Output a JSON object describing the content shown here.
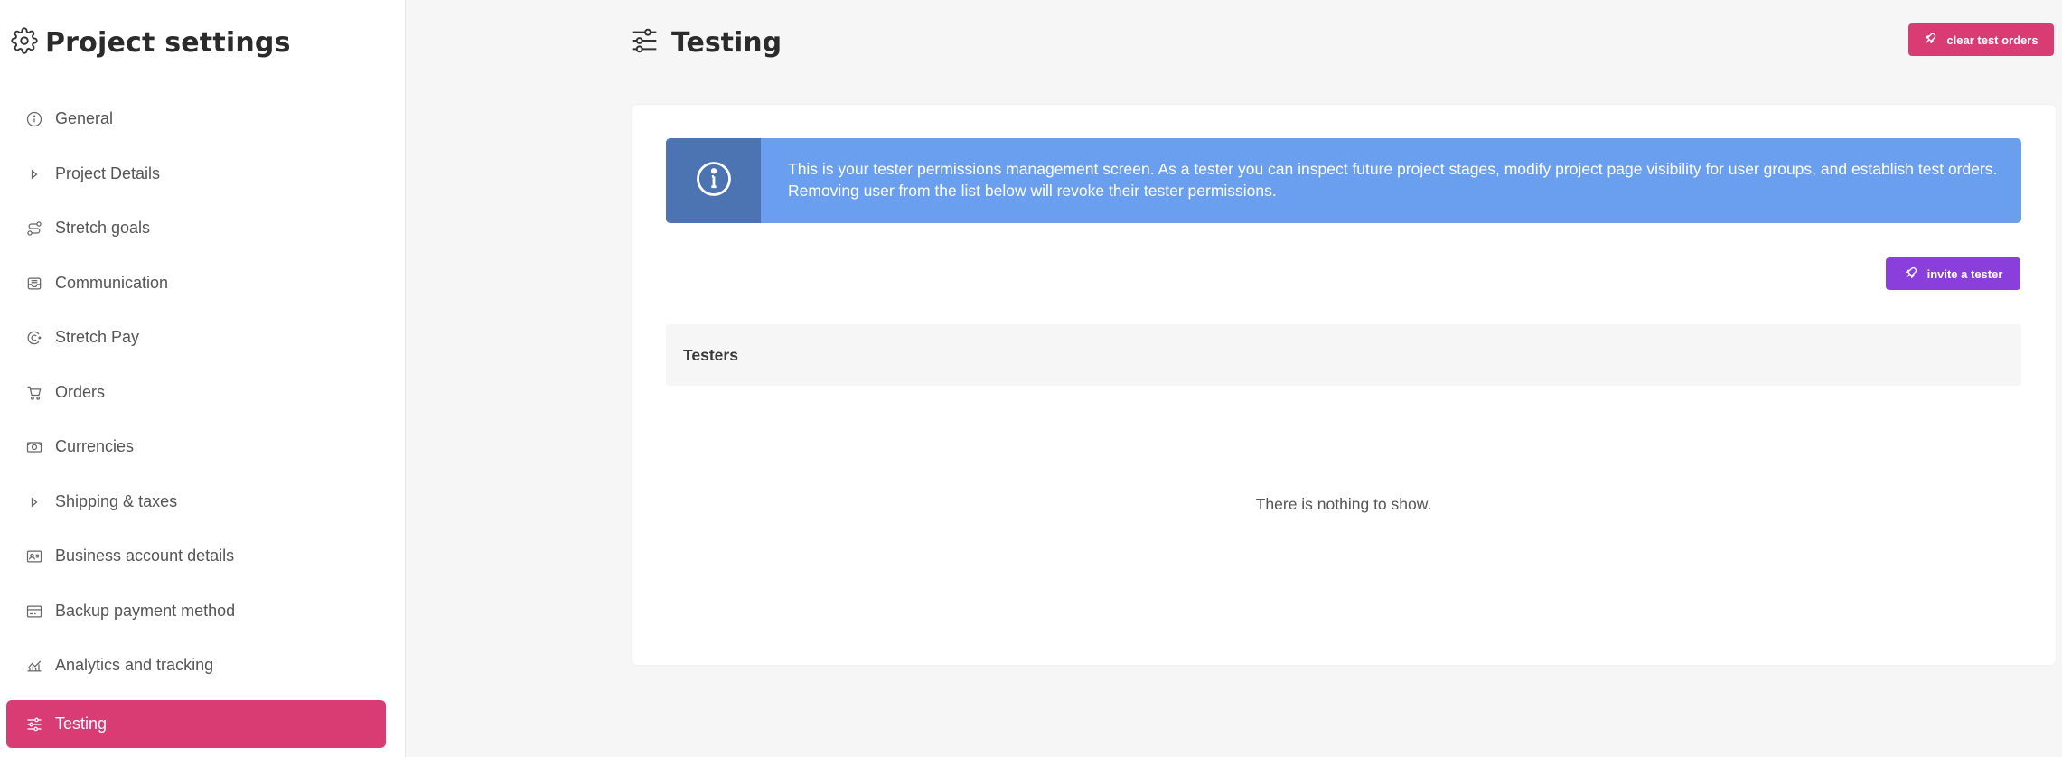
{
  "sidebar": {
    "title": "Project settings",
    "title_icon": "gear-icon",
    "items": [
      {
        "label": "General",
        "icon": "info-circle-icon"
      },
      {
        "label": "Project Details",
        "icon": "caret-right-icon"
      },
      {
        "label": "Stretch goals",
        "icon": "route-icon"
      },
      {
        "label": "Communication",
        "icon": "inbox-icon"
      },
      {
        "label": "Stretch Pay",
        "icon": "stretchpay-icon"
      },
      {
        "label": "Orders",
        "icon": "cart-icon"
      },
      {
        "label": "Currencies",
        "icon": "cash-icon"
      },
      {
        "label": "Shipping & taxes",
        "icon": "caret-right-icon"
      },
      {
        "label": "Business account details",
        "icon": "id-card-icon"
      },
      {
        "label": "Backup payment method",
        "icon": "credit-card-icon"
      },
      {
        "label": "Analytics and tracking",
        "icon": "chart-icon"
      },
      {
        "label": "Testing",
        "icon": "sliders-icon",
        "active": true
      }
    ]
  },
  "header": {
    "title": "Testing",
    "icon": "sliders-icon",
    "clear_button_label": "clear test orders"
  },
  "main": {
    "info_text": "This is your tester permissions management screen. As a tester you can inspect future project stages, modify project page visibility for user groups, and establish test orders. Removing user from the list below will revoke their tester permissions.",
    "invite_button_label": "invite a tester",
    "testers_heading": "Testers",
    "empty_text": "There is nothing to show."
  },
  "colors": {
    "accent_pink": "#d93c73",
    "accent_purple": "#8a3fdc",
    "info_blue": "#6a9ff0",
    "info_blue_dark": "#4c74b3"
  }
}
